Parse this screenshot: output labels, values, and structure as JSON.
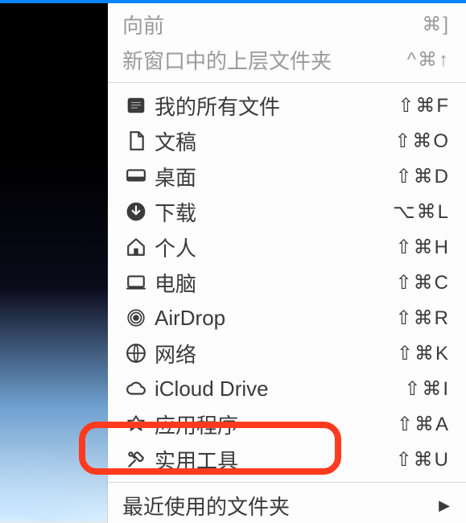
{
  "topDisabled": [
    {
      "label": "向前",
      "shortcut": "⌘]"
    },
    {
      "label": "新窗口中的上层文件夹",
      "shortcut": "^⌘↑"
    }
  ],
  "goItems": [
    {
      "icon": "all-files",
      "label": "我的所有文件",
      "shortcut": "⇧⌘F"
    },
    {
      "icon": "documents",
      "label": "文稿",
      "shortcut": "⇧⌘O"
    },
    {
      "icon": "desktop",
      "label": "桌面",
      "shortcut": "⇧⌘D"
    },
    {
      "icon": "downloads",
      "label": "下载",
      "shortcut": "⌥⌘L"
    },
    {
      "icon": "home",
      "label": "个人",
      "shortcut": "⇧⌘H"
    },
    {
      "icon": "computer",
      "label": "电脑",
      "shortcut": "⇧⌘C"
    },
    {
      "icon": "airdrop",
      "label": "AirDrop",
      "shortcut": "⇧⌘R"
    },
    {
      "icon": "network",
      "label": "网络",
      "shortcut": "⇧⌘K"
    },
    {
      "icon": "icloud",
      "label": "iCloud Drive",
      "shortcut": "⇧⌘I"
    },
    {
      "icon": "applications",
      "label": "应用程序",
      "shortcut": "⇧⌘A"
    },
    {
      "icon": "utilities",
      "label": "实用工具",
      "shortcut": "⇧⌘U"
    }
  ],
  "recent": {
    "label": "最近使用的文件夹"
  }
}
